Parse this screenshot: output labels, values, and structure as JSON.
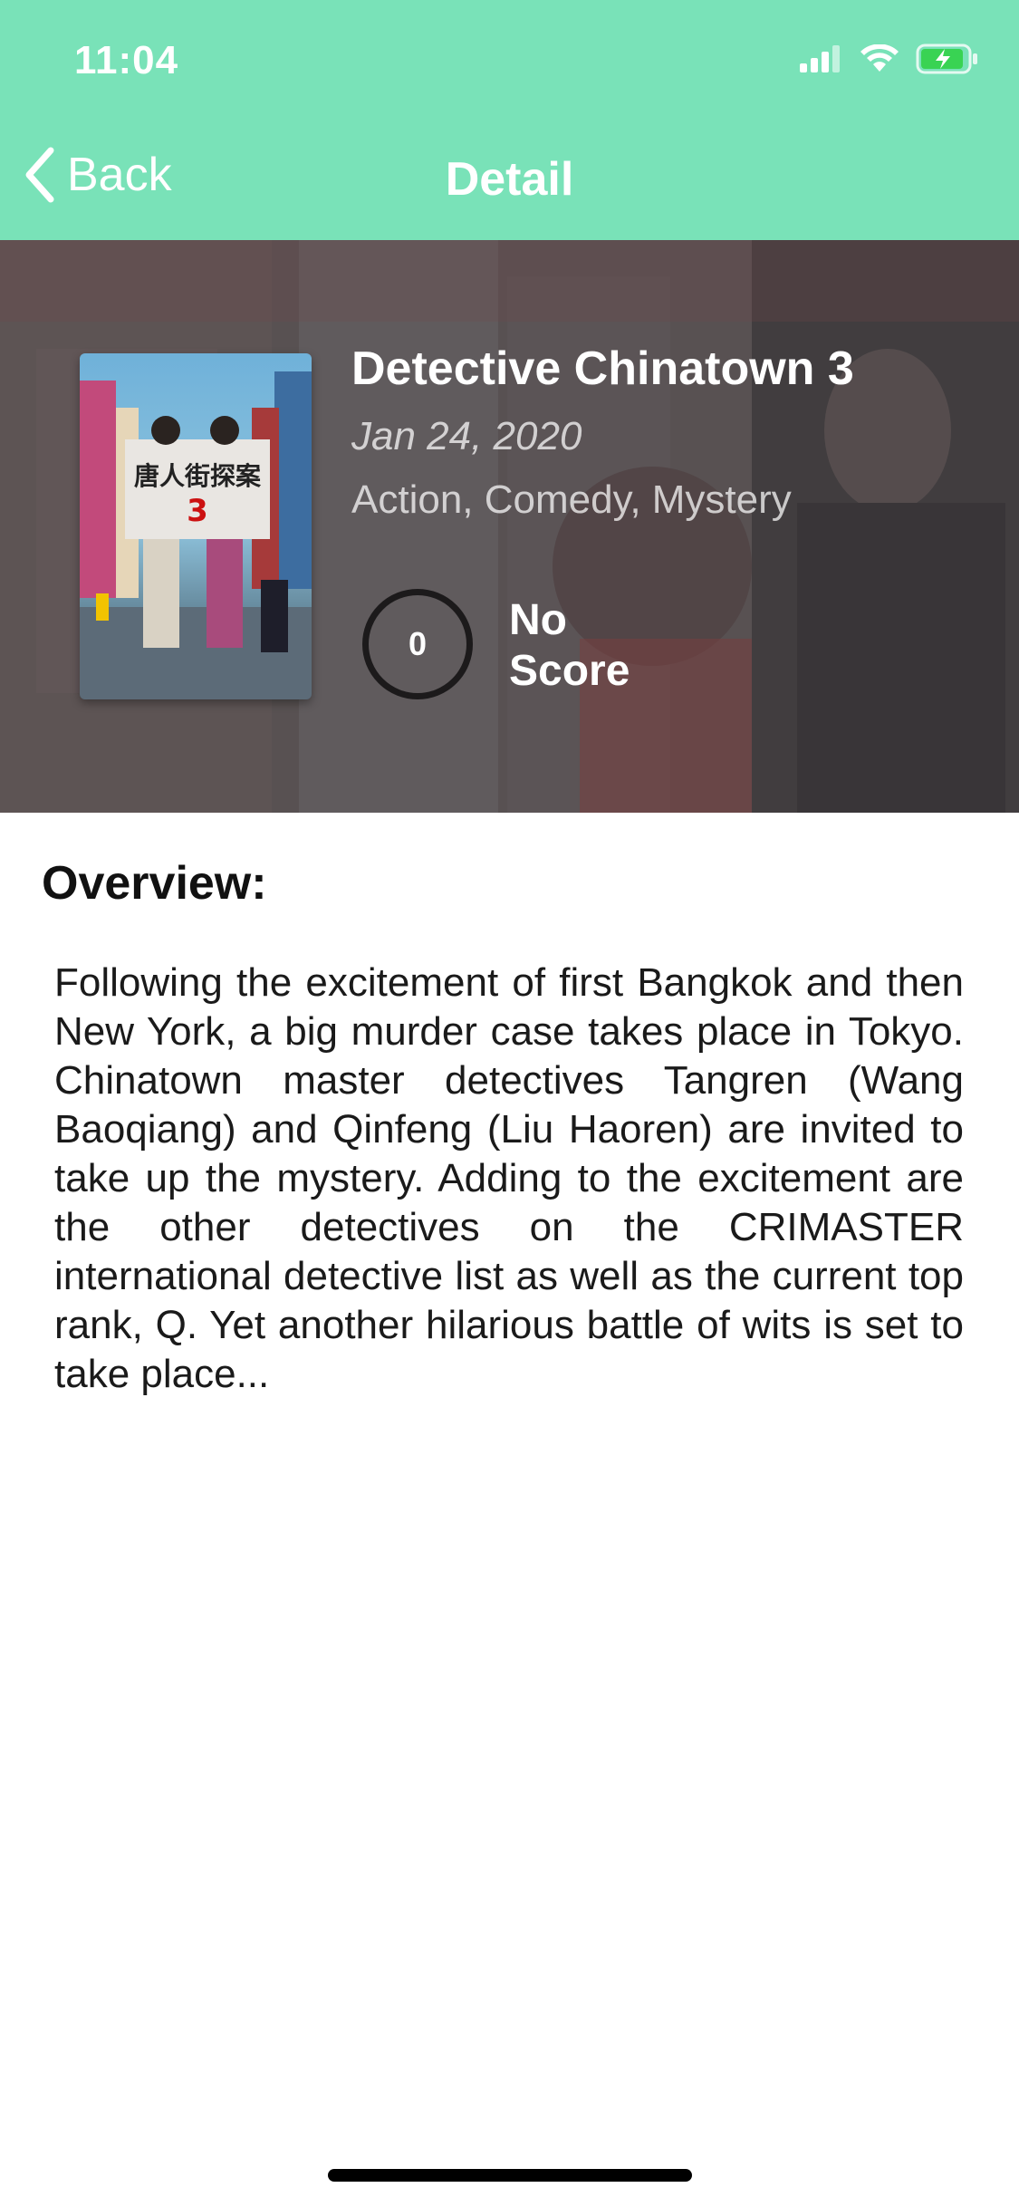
{
  "status_bar": {
    "time": "11:04"
  },
  "nav": {
    "back_label": "Back",
    "title": "Detail"
  },
  "movie": {
    "title": "Detective Chinatown 3",
    "release_date": "Jan 24, 2020",
    "genres": "Action, Comedy, Mystery",
    "score_value": "0",
    "score_label": "No Score"
  },
  "overview": {
    "heading": "Overview:",
    "text": "Following the excitement of first Bangkok and then New York, a big murder case takes place in Tokyo. Chinatown master detectives Tangren (Wang Baoqiang) and Qinfeng (Liu Haoren) are invited to take up the mystery. Adding to the excitement are the other detectives on the CRIMASTER international detective list as well as the current top rank, Q. Yet another hilarious battle of wits is set to take place..."
  },
  "colors": {
    "accent": "#79e2b8",
    "nav_text": "#ffffff",
    "body_text": "#1a1a1a"
  },
  "icons": [
    "cellular-signal-icon",
    "wifi-icon",
    "battery-charging-icon",
    "chevron-left-icon"
  ]
}
